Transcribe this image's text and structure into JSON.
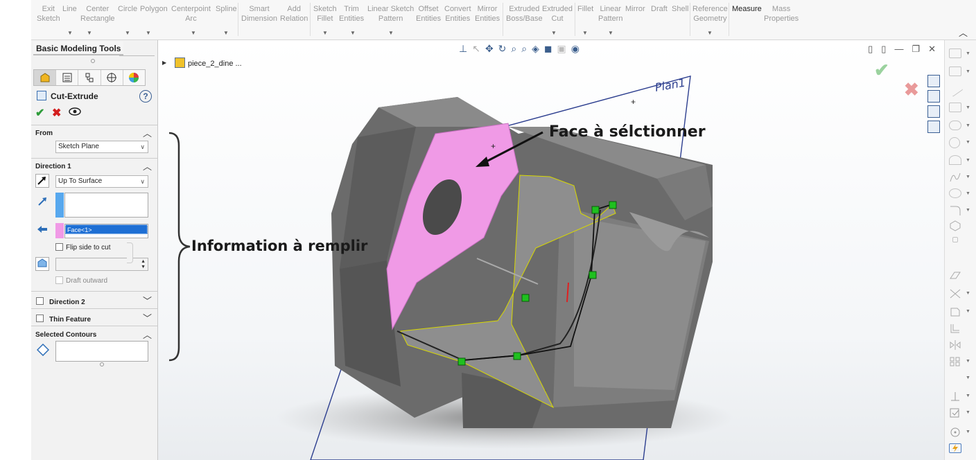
{
  "ribbon": {
    "items": [
      {
        "label": "Exit\nSketch"
      },
      {
        "label": "Line"
      },
      {
        "label": "Center\nRectangle"
      },
      {
        "label": "Circle"
      },
      {
        "label": "Polygon"
      },
      {
        "label": "Centerpoint\nArc"
      },
      {
        "label": "Spline"
      },
      {
        "label": "Smart\nDimension"
      },
      {
        "label": "Add\nRelation"
      },
      {
        "label": "Sketch\nFillet"
      },
      {
        "label": "Trim\nEntities"
      },
      {
        "label": "Linear Sketch\nPattern"
      },
      {
        "label": "Offset\nEntities"
      },
      {
        "label": "Convert\nEntities"
      },
      {
        "label": "Mirror\nEntities"
      },
      {
        "label": "Extruded\nBoss/Base"
      },
      {
        "label": "Extruded\nCut"
      },
      {
        "label": "Fillet"
      },
      {
        "label": "Linear\nPattern"
      },
      {
        "label": "Mirror"
      },
      {
        "label": "Draft"
      },
      {
        "label": "Shell"
      },
      {
        "label": "Reference\nGeometry"
      },
      {
        "label": "Measure"
      },
      {
        "label": "Mass\nProperties"
      }
    ]
  },
  "panel": {
    "tab_label": "Basic Modeling Tools",
    "feature_title": "Cut-Extrude",
    "help": "?",
    "from": {
      "title": "From",
      "value": "Sketch Plane"
    },
    "direction1": {
      "title": "Direction 1",
      "end_condition": "Up To Surface",
      "face_value": "Face<1>",
      "flip_label": "Flip side to cut",
      "draft_label": "Draft outward"
    },
    "direction2": {
      "title": "Direction 2"
    },
    "thin_feature": {
      "title": "Thin Feature"
    },
    "selected_contours": {
      "title": "Selected Contours"
    }
  },
  "graphics": {
    "tree_item": "piece_2_dine ...",
    "plane_label": "Plan1"
  },
  "annotations": {
    "face_note": "Face à sélctionner",
    "info_note": "Information à remplir"
  },
  "colors": {
    "selected_face": "#f09ae6",
    "model_body": "#6e6e6e",
    "sketch_outline": "#d8d800",
    "handle": "#1fc01f",
    "plane": "#2c3e8f"
  }
}
